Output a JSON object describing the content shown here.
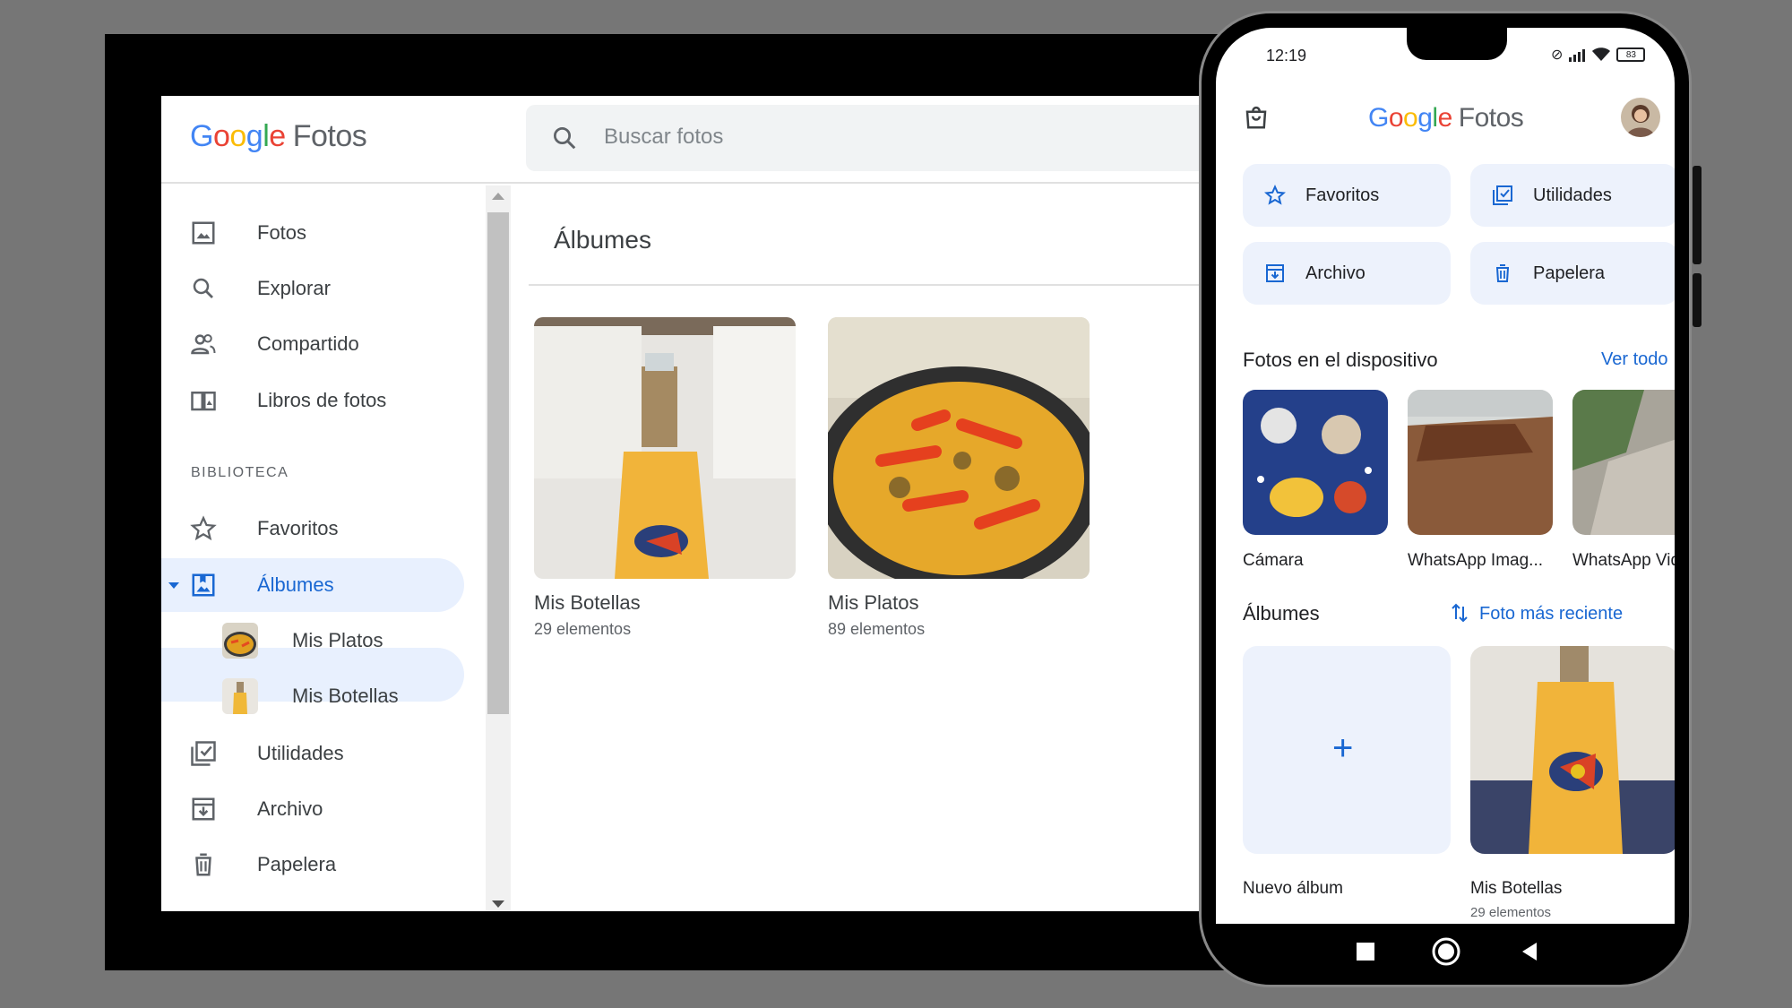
{
  "desktop": {
    "logo": {
      "google": "Google",
      "app": "Fotos"
    },
    "search": {
      "placeholder": "Buscar fotos"
    },
    "nav": {
      "fotos": "Fotos",
      "explorar": "Explorar",
      "compartido": "Compartido",
      "libros": "Libros de fotos",
      "section_header": "BIBLIOTECA",
      "favoritos": "Favoritos",
      "albumes": "Álbumes",
      "sub_mis_platos": "Mis Platos",
      "sub_mis_botellas": "Mis Botellas",
      "utilidades": "Utilidades",
      "archivo": "Archivo",
      "papelera": "Papelera"
    },
    "main": {
      "title": "Álbumes",
      "albums": [
        {
          "name": "Mis Botellas",
          "count": "29 elementos"
        },
        {
          "name": "Mis Platos",
          "count": "89 elementos"
        }
      ]
    }
  },
  "phone": {
    "status": {
      "time": "12:19",
      "battery": "83"
    },
    "logo": {
      "google": "Google",
      "app": "Fotos"
    },
    "chips": {
      "favoritos": "Favoritos",
      "utilidades": "Utilidades",
      "archivo": "Archivo",
      "papelera": "Papelera"
    },
    "device_section": {
      "title": "Fotos en el dispositivo",
      "link": "Ver todo"
    },
    "device_folders": [
      {
        "label": "Cámara"
      },
      {
        "label": "WhatsApp Imag..."
      },
      {
        "label": "WhatsApp Vide"
      }
    ],
    "albums_section": {
      "title": "Álbumes",
      "sort": "Foto más reciente"
    },
    "albums": {
      "new": {
        "plus": "+",
        "label": "Nuevo álbum"
      },
      "botellas": {
        "label": "Mis Botellas",
        "count": "29 elementos"
      }
    }
  },
  "colors": {
    "accent": "#1967d2",
    "active_bg": "#e8f0fe",
    "chip_bg": "#edf2fc"
  }
}
